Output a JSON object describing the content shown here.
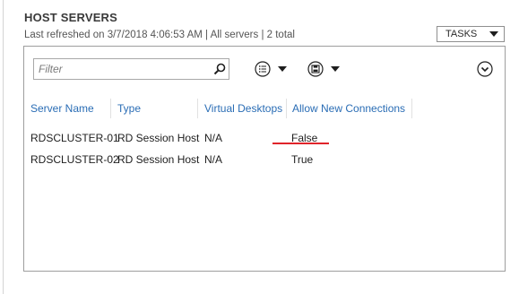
{
  "header": {
    "title": "HOST SERVERS",
    "subtitle": "Last refreshed on 3/7/2018 4:06:53 AM | All servers  | 2 total"
  },
  "tasks": {
    "label": "TASKS"
  },
  "filter": {
    "placeholder": "Filter"
  },
  "table": {
    "columns": [
      "Server Name",
      "Type",
      "Virtual Desktops",
      "Allow New Connections"
    ],
    "rows": [
      [
        "RDSCLUSTER-01",
        "RD Session Host",
        "N/A",
        "False"
      ],
      [
        "RDSCLUSTER-02",
        "RD Session Host",
        "N/A",
        "True"
      ]
    ]
  },
  "icons": {
    "search": "search-icon",
    "list_options": "list-options-icon",
    "save_query": "save-icon",
    "expand": "chevron-down-circle-icon"
  },
  "colors": {
    "header_link": "#2a6db5",
    "highlight_underline": "#e0242a"
  }
}
